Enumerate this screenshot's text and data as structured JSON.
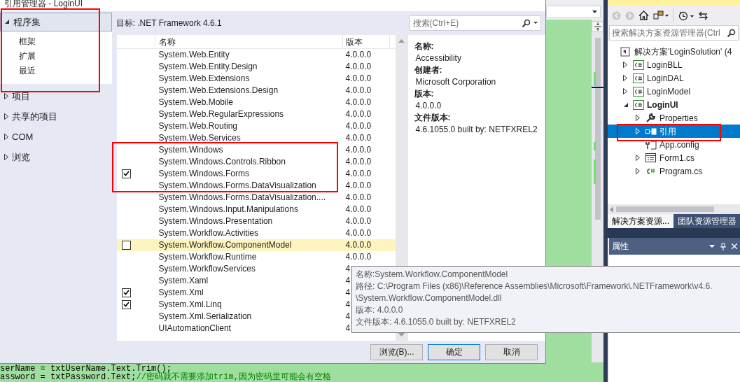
{
  "dialog": {
    "title": "引用管理器 - LoginUI",
    "nav": [
      {
        "label": "程序集",
        "expanded": true,
        "selected": true,
        "children": [
          {
            "label": "框架",
            "selected": false
          },
          {
            "label": "扩展",
            "selected": false
          },
          {
            "label": "最近",
            "selected": false
          }
        ]
      },
      {
        "label": "项目",
        "expanded": false,
        "selected": false
      },
      {
        "label": "共享的项目",
        "expanded": false,
        "selected": false
      },
      {
        "label": "COM",
        "expanded": false,
        "selected": false
      },
      {
        "label": "浏览",
        "expanded": false,
        "selected": false
      }
    ],
    "target": "目标: .NET Framework 4.6.1",
    "search": {
      "placeholder": "搜索(Ctrl+E)"
    },
    "table": {
      "columns": [
        "名称",
        "版本"
      ],
      "rows": [
        {
          "name": "System.Web.Entity",
          "version": "4.0.0.0",
          "checked": false,
          "hovered": false
        },
        {
          "name": "System.Web.Entity.Design",
          "version": "4.0.0.0",
          "checked": false,
          "hovered": false
        },
        {
          "name": "System.Web.Extensions",
          "version": "4.0.0.0",
          "checked": false,
          "hovered": false
        },
        {
          "name": "System.Web.Extensions.Design",
          "version": "4.0.0.0",
          "checked": false,
          "hovered": false
        },
        {
          "name": "System.Web.Mobile",
          "version": "4.0.0.0",
          "checked": false,
          "hovered": false
        },
        {
          "name": "System.Web.RegularExpressions",
          "version": "4.0.0.0",
          "checked": false,
          "hovered": false
        },
        {
          "name": "System.Web.Routing",
          "version": "4.0.0.0",
          "checked": false,
          "hovered": false
        },
        {
          "name": "System.Web.Services",
          "version": "4.0.0.0",
          "checked": false,
          "hovered": false
        },
        {
          "name": "System.Windows",
          "version": "4.0.0.0",
          "checked": false,
          "hovered": false
        },
        {
          "name": "System.Windows.Controls.Ribbon",
          "version": "4.0.0.0",
          "checked": false,
          "hovered": false
        },
        {
          "name": "System.Windows.Forms",
          "version": "4.0.0.0",
          "checked": true,
          "hovered": false
        },
        {
          "name": "System.Windows.Forms.DataVisualization",
          "version": "4.0.0.0",
          "checked": false,
          "hovered": false
        },
        {
          "name": "System.Windows.Forms.DataVisualization....",
          "version": "4.0.0.0",
          "checked": false,
          "hovered": false
        },
        {
          "name": "System.Windows.Input.Manipulations",
          "version": "4.0.0.0",
          "checked": false,
          "hovered": false
        },
        {
          "name": "System.Windows.Presentation",
          "version": "4.0.0.0",
          "checked": false,
          "hovered": false
        },
        {
          "name": "System.Workflow.Activities",
          "version": "4.0.0.0",
          "checked": false,
          "hovered": false
        },
        {
          "name": "System.Workflow.ComponentModel",
          "version": "4.0.0.0",
          "checked": false,
          "hovered": true
        },
        {
          "name": "System.Workflow.Runtime",
          "version": "4.0.0.0",
          "checked": false,
          "hovered": false
        },
        {
          "name": "System.WorkflowServices",
          "version": "4",
          "checked": false,
          "hovered": false
        },
        {
          "name": "System.Xaml",
          "version": "4",
          "checked": false,
          "hovered": false
        },
        {
          "name": "System.Xml",
          "version": "4",
          "checked": true,
          "hovered": false
        },
        {
          "name": "System.Xml.Linq",
          "version": "4",
          "checked": true,
          "hovered": false
        },
        {
          "name": "System.Xml.Serialization",
          "version": "4",
          "checked": false,
          "hovered": false
        },
        {
          "name": "UIAutomationClient",
          "version": "4",
          "checked": false,
          "hovered": false
        }
      ]
    },
    "details": [
      {
        "label": "名称:",
        "value": "Accessibility"
      },
      {
        "label": "创建者:",
        "value": "Microsoft Corporation"
      },
      {
        "label": "版本:",
        "value": "4.0.0.0"
      },
      {
        "label": "文件版本:",
        "value": "4.6.1055.0 built by: NETFXREL2"
      }
    ],
    "buttons": [
      {
        "label": "浏览(B)...",
        "default": false
      },
      {
        "label": "确定",
        "default": true
      },
      {
        "label": "取消",
        "default": false
      }
    ],
    "tooltip": [
      "名称:System.Workflow.ComponentModel",
      "路径: C:\\Program Files (x86)\\Reference Assemblies\\Microsoft\\Framework\\.NETFramework\\v4.6.",
      "\\System.Workflow.ComponentModel.dll",
      "版本: 4.0.0.0",
      "文件版本: 4.6.1055.0 built by: NETFXREL2"
    ]
  },
  "code_lines": [
    {
      "code": "serName = txtUserName.Text.Trim();"
    },
    {
      "code": "assword = txtPassword.Text;",
      "comment": "//密码就不需要添加trim,因为密码里可能会有空格"
    }
  ],
  "solution_explorer": {
    "search": {
      "placeholder": "搜索解决方案资源管理器(Ctrl"
    },
    "tree": [
      {
        "label": "解决方案'LoginSolution' (4",
        "kind": "solution",
        "children": [
          {
            "label": "LoginBLL",
            "kind": "project",
            "expanded": false,
            "startup": false
          },
          {
            "label": "LoginDAL",
            "kind": "project",
            "expanded": false,
            "startup": false
          },
          {
            "label": "LoginModel",
            "kind": "project",
            "expanded": false,
            "startup": false
          },
          {
            "label": "LoginUI",
            "kind": "project",
            "expanded": true,
            "startup": true,
            "children": [
              {
                "label": "Properties",
                "kind": "properties",
                "expanded": false,
                "selected": false
              },
              {
                "label": "引用",
                "kind": "references",
                "expanded": false,
                "selected": true
              },
              {
                "label": "App.config",
                "kind": "config",
                "selected": false
              },
              {
                "label": "Form1.cs",
                "kind": "form",
                "expanded": false,
                "selected": false
              },
              {
                "label": "Program.cs",
                "kind": "csharp",
                "expanded": false,
                "selected": false
              }
            ]
          }
        ]
      }
    ],
    "tabs": [
      {
        "label": "解决方案资源...",
        "selected": true
      },
      {
        "label": "团队资源管理器",
        "selected": false
      }
    ]
  },
  "properties_panel": {
    "title": "属性"
  }
}
